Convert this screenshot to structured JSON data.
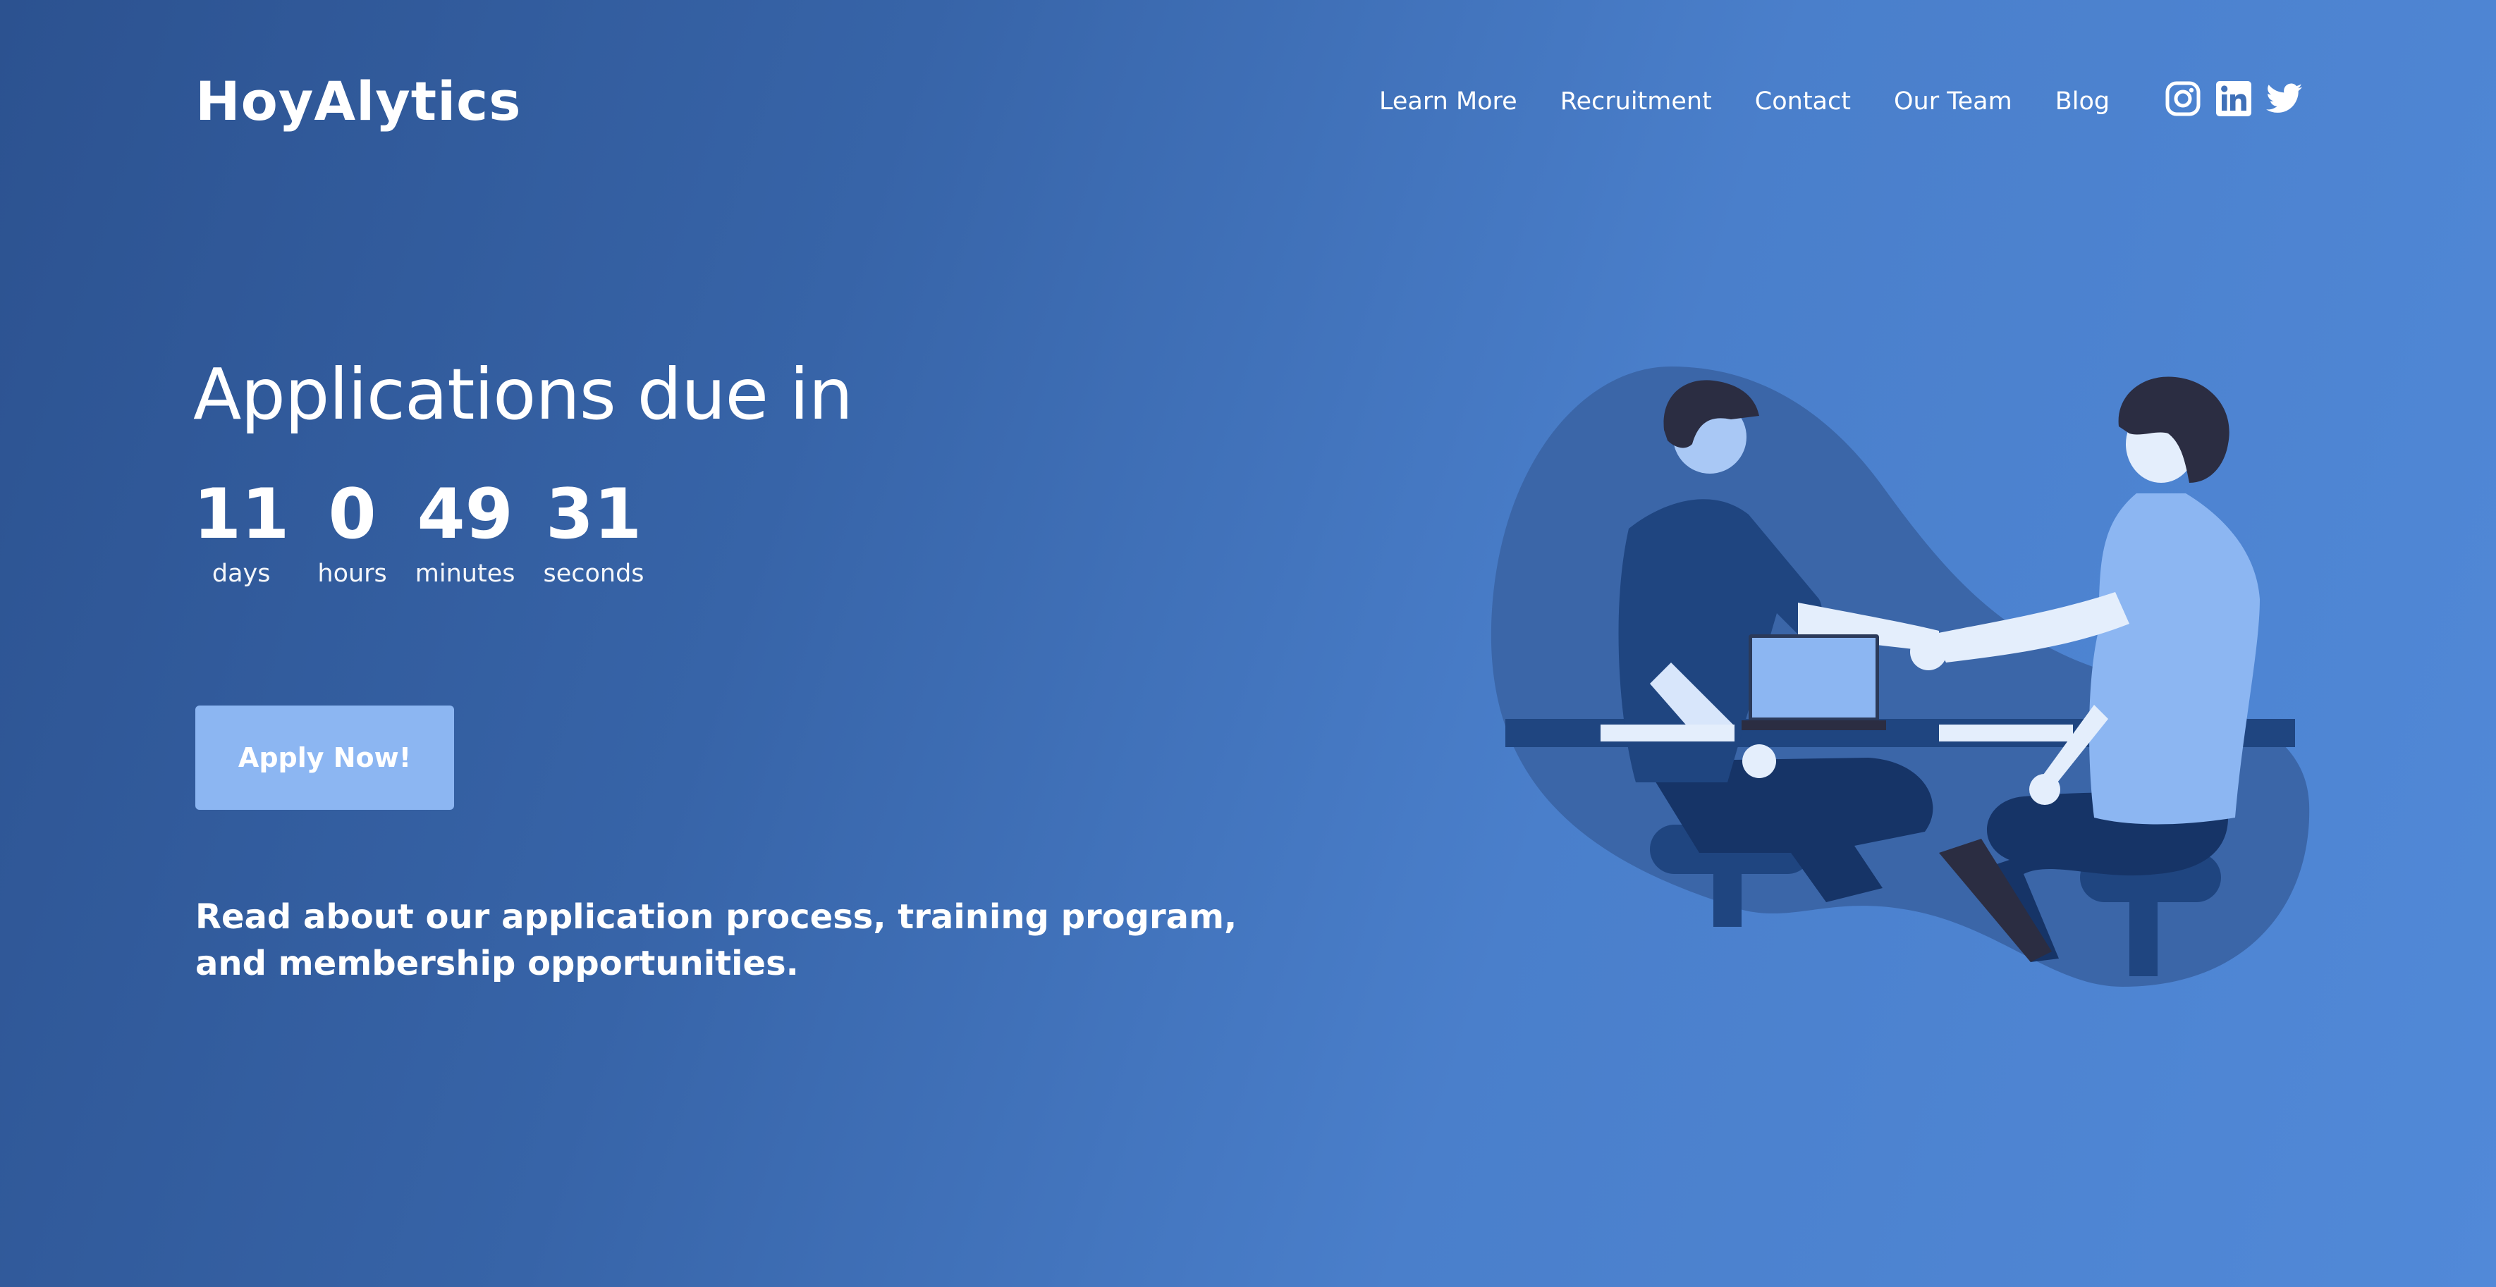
{
  "brand": {
    "name": "HoyAlytics"
  },
  "nav": {
    "items": [
      {
        "label": "Learn More"
      },
      {
        "label": "Recruitment"
      },
      {
        "label": "Contact"
      },
      {
        "label": "Our Team"
      },
      {
        "label": "Blog"
      }
    ]
  },
  "socials": [
    {
      "icon": "instagram-icon"
    },
    {
      "icon": "linkedin-icon"
    },
    {
      "icon": "twitter-icon"
    }
  ],
  "hero": {
    "headline": "Applications due in",
    "countdown": [
      {
        "value": "11",
        "label": "days"
      },
      {
        "value": "0",
        "label": "hours"
      },
      {
        "value": "49",
        "label": "minutes"
      },
      {
        "value": "31",
        "label": "seconds"
      }
    ],
    "cta_label": "Apply Now!",
    "blurb": "Read about our application process, training program, and membership opportunities."
  },
  "illustration": {
    "icon": "handshake-illustration"
  },
  "colors": {
    "background_start": "#2c5290",
    "background_end": "#5189d8",
    "button": "#8cb6f2",
    "text": "#ffffff"
  }
}
